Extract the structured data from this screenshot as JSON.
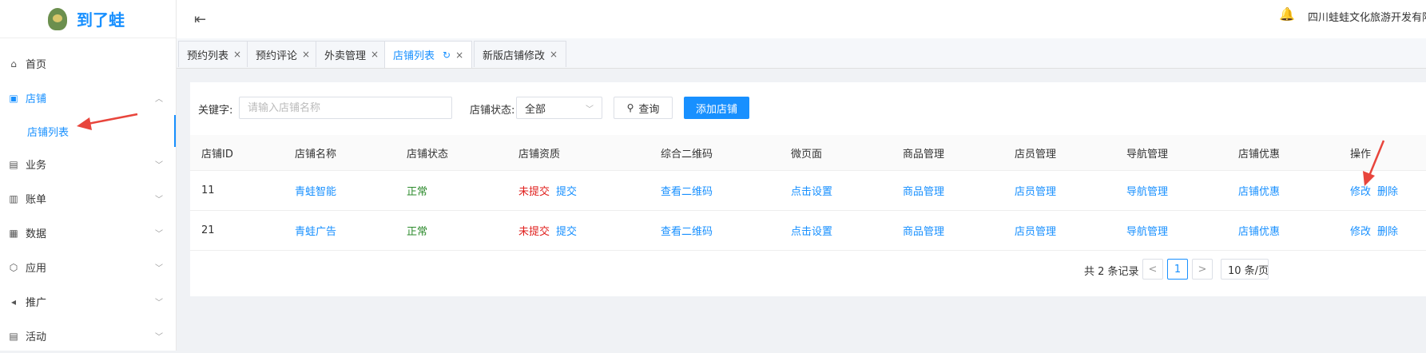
{
  "app": {
    "name": "到了蛙",
    "company": "四川蛙蛙文化旅游开发有限"
  },
  "sidebar": {
    "items": [
      {
        "label": "首页",
        "icon": "home-icon",
        "glyph": "⌂"
      },
      {
        "label": "店铺",
        "icon": "store-icon",
        "glyph": "▣",
        "open": true,
        "children": [
          {
            "label": "店铺列表"
          }
        ]
      },
      {
        "label": "业务",
        "icon": "business-icon",
        "glyph": "▤"
      },
      {
        "label": "账单",
        "icon": "bill-icon",
        "glyph": "▥"
      },
      {
        "label": "数据",
        "icon": "data-icon",
        "glyph": "▦"
      },
      {
        "label": "应用",
        "icon": "app-icon",
        "glyph": "⬡"
      },
      {
        "label": "推广",
        "icon": "promotion-icon",
        "glyph": "◂"
      },
      {
        "label": "活动",
        "icon": "activity-icon",
        "glyph": "▤"
      }
    ]
  },
  "tabs": [
    {
      "label": "预约列表"
    },
    {
      "label": "预约评论"
    },
    {
      "label": "外卖管理"
    },
    {
      "label": "店铺列表",
      "active": true
    },
    {
      "label": "新版店铺修改"
    }
  ],
  "search": {
    "keyword_label": "关键字:",
    "keyword_placeholder": "请输入店铺名称",
    "keyword_value": "",
    "status_label": "店铺状态:",
    "status_value": "全部",
    "query_label": "查询",
    "add_label": "添加店铺"
  },
  "table": {
    "columns": [
      "店铺ID",
      "店铺名称",
      "店铺状态",
      "店铺资质",
      "综合二维码",
      "微页面",
      "商品管理",
      "店员管理",
      "导航管理",
      "店铺优惠",
      "操作"
    ],
    "rows": [
      {
        "id": "11",
        "name": "青蛙智能",
        "status": "正常",
        "qual_status": "未提交",
        "qual_action": "提交",
        "qr": "查看二维码",
        "page": "点击设置",
        "goods": "商品管理",
        "staff": "店员管理",
        "nav": "导航管理",
        "promo": "店铺优惠",
        "edit": "修改",
        "delete": "删除"
      },
      {
        "id": "21",
        "name": "青蛙广告",
        "status": "正常",
        "qual_status": "未提交",
        "qual_action": "提交",
        "qr": "查看二维码",
        "page": "点击设置",
        "goods": "商品管理",
        "staff": "店员管理",
        "nav": "导航管理",
        "promo": "店铺优惠",
        "edit": "修改",
        "delete": "删除"
      }
    ]
  },
  "pagination": {
    "total_text": "共 2 条记录",
    "prev": "<",
    "current": "1",
    "next": ">",
    "page_size": "10 条/页"
  },
  "colors": {
    "accent": "#1890ff",
    "ok": "#2e8b2e",
    "danger": "#e0201e",
    "annotation": "#e8453c"
  }
}
